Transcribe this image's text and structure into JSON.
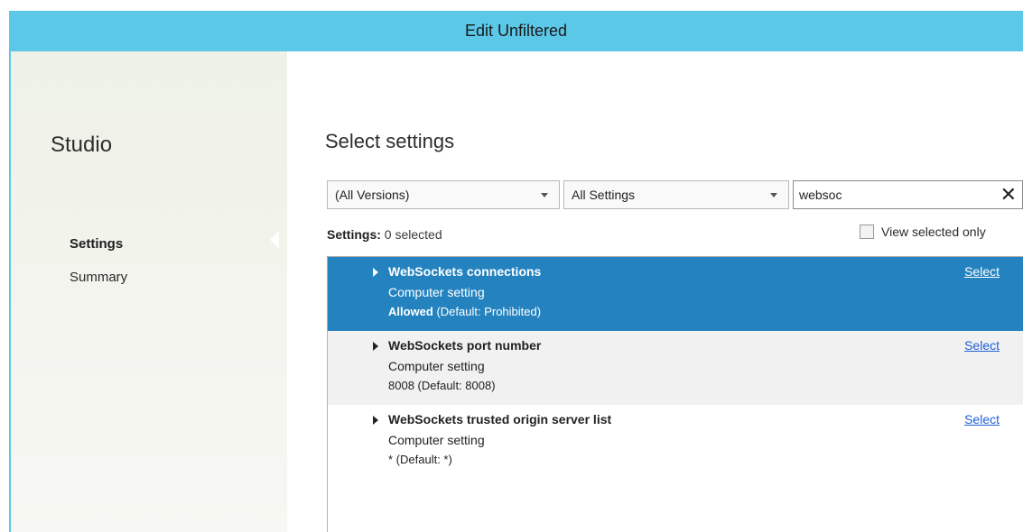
{
  "window": {
    "title": "Edit Unfiltered"
  },
  "sidebar": {
    "title": "Studio",
    "items": [
      {
        "label": "Settings",
        "active": true
      },
      {
        "label": "Summary",
        "active": false
      }
    ]
  },
  "main": {
    "title": "Select settings",
    "filters": {
      "versions": "(All Versions)",
      "category": "All Settings",
      "search_value": "websoc"
    },
    "settings_label": "Settings:",
    "selected_count": "0 selected",
    "view_selected_label": "View selected only",
    "rows": [
      {
        "name": "WebSockets connections",
        "type": "Computer setting",
        "value": "Allowed",
        "default": " (Default: Prohibited)",
        "action": "Select",
        "selected": true
      },
      {
        "name": "WebSockets port number",
        "type": "Computer setting",
        "value": "8008",
        "default": " (Default: 8008)",
        "action": "Select",
        "selected": false
      },
      {
        "name": "WebSockets trusted origin server list",
        "type": "Computer setting",
        "value": "*",
        "default": " (Default: *)",
        "action": "Select",
        "selected": false
      }
    ]
  },
  "icons": {
    "dropdown": "chevron-down-icon",
    "clear": "close-icon",
    "expand": "caret-right-icon"
  },
  "colors": {
    "titlebar": "#5cc8e8",
    "selection": "#2483bf",
    "link": "#1f5fd4"
  }
}
